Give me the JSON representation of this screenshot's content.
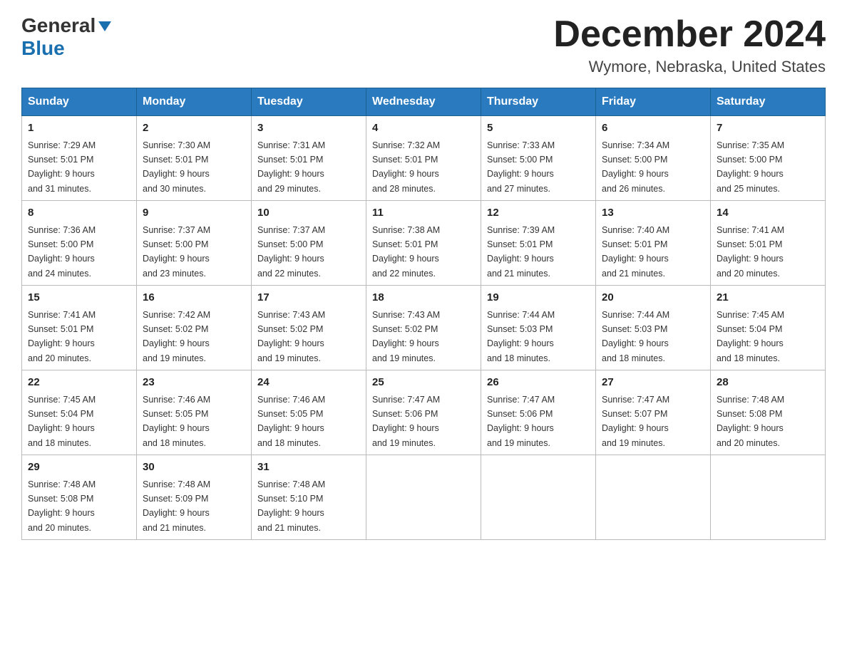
{
  "header": {
    "logo_general": "General",
    "logo_blue": "Blue",
    "month_title": "December 2024",
    "location": "Wymore, Nebraska, United States"
  },
  "weekdays": [
    "Sunday",
    "Monday",
    "Tuesday",
    "Wednesday",
    "Thursday",
    "Friday",
    "Saturday"
  ],
  "weeks": [
    [
      {
        "day": "1",
        "sunrise": "7:29 AM",
        "sunset": "5:01 PM",
        "daylight": "9 hours and 31 minutes."
      },
      {
        "day": "2",
        "sunrise": "7:30 AM",
        "sunset": "5:01 PM",
        "daylight": "9 hours and 30 minutes."
      },
      {
        "day": "3",
        "sunrise": "7:31 AM",
        "sunset": "5:01 PM",
        "daylight": "9 hours and 29 minutes."
      },
      {
        "day": "4",
        "sunrise": "7:32 AM",
        "sunset": "5:01 PM",
        "daylight": "9 hours and 28 minutes."
      },
      {
        "day": "5",
        "sunrise": "7:33 AM",
        "sunset": "5:00 PM",
        "daylight": "9 hours and 27 minutes."
      },
      {
        "day": "6",
        "sunrise": "7:34 AM",
        "sunset": "5:00 PM",
        "daylight": "9 hours and 26 minutes."
      },
      {
        "day": "7",
        "sunrise": "7:35 AM",
        "sunset": "5:00 PM",
        "daylight": "9 hours and 25 minutes."
      }
    ],
    [
      {
        "day": "8",
        "sunrise": "7:36 AM",
        "sunset": "5:00 PM",
        "daylight": "9 hours and 24 minutes."
      },
      {
        "day": "9",
        "sunrise": "7:37 AM",
        "sunset": "5:00 PM",
        "daylight": "9 hours and 23 minutes."
      },
      {
        "day": "10",
        "sunrise": "7:37 AM",
        "sunset": "5:00 PM",
        "daylight": "9 hours and 22 minutes."
      },
      {
        "day": "11",
        "sunrise": "7:38 AM",
        "sunset": "5:01 PM",
        "daylight": "9 hours and 22 minutes."
      },
      {
        "day": "12",
        "sunrise": "7:39 AM",
        "sunset": "5:01 PM",
        "daylight": "9 hours and 21 minutes."
      },
      {
        "day": "13",
        "sunrise": "7:40 AM",
        "sunset": "5:01 PM",
        "daylight": "9 hours and 21 minutes."
      },
      {
        "day": "14",
        "sunrise": "7:41 AM",
        "sunset": "5:01 PM",
        "daylight": "9 hours and 20 minutes."
      }
    ],
    [
      {
        "day": "15",
        "sunrise": "7:41 AM",
        "sunset": "5:01 PM",
        "daylight": "9 hours and 20 minutes."
      },
      {
        "day": "16",
        "sunrise": "7:42 AM",
        "sunset": "5:02 PM",
        "daylight": "9 hours and 19 minutes."
      },
      {
        "day": "17",
        "sunrise": "7:43 AM",
        "sunset": "5:02 PM",
        "daylight": "9 hours and 19 minutes."
      },
      {
        "day": "18",
        "sunrise": "7:43 AM",
        "sunset": "5:02 PM",
        "daylight": "9 hours and 19 minutes."
      },
      {
        "day": "19",
        "sunrise": "7:44 AM",
        "sunset": "5:03 PM",
        "daylight": "9 hours and 18 minutes."
      },
      {
        "day": "20",
        "sunrise": "7:44 AM",
        "sunset": "5:03 PM",
        "daylight": "9 hours and 18 minutes."
      },
      {
        "day": "21",
        "sunrise": "7:45 AM",
        "sunset": "5:04 PM",
        "daylight": "9 hours and 18 minutes."
      }
    ],
    [
      {
        "day": "22",
        "sunrise": "7:45 AM",
        "sunset": "5:04 PM",
        "daylight": "9 hours and 18 minutes."
      },
      {
        "day": "23",
        "sunrise": "7:46 AM",
        "sunset": "5:05 PM",
        "daylight": "9 hours and 18 minutes."
      },
      {
        "day": "24",
        "sunrise": "7:46 AM",
        "sunset": "5:05 PM",
        "daylight": "9 hours and 18 minutes."
      },
      {
        "day": "25",
        "sunrise": "7:47 AM",
        "sunset": "5:06 PM",
        "daylight": "9 hours and 19 minutes."
      },
      {
        "day": "26",
        "sunrise": "7:47 AM",
        "sunset": "5:06 PM",
        "daylight": "9 hours and 19 minutes."
      },
      {
        "day": "27",
        "sunrise": "7:47 AM",
        "sunset": "5:07 PM",
        "daylight": "9 hours and 19 minutes."
      },
      {
        "day": "28",
        "sunrise": "7:48 AM",
        "sunset": "5:08 PM",
        "daylight": "9 hours and 20 minutes."
      }
    ],
    [
      {
        "day": "29",
        "sunrise": "7:48 AM",
        "sunset": "5:08 PM",
        "daylight": "9 hours and 20 minutes."
      },
      {
        "day": "30",
        "sunrise": "7:48 AM",
        "sunset": "5:09 PM",
        "daylight": "9 hours and 21 minutes."
      },
      {
        "day": "31",
        "sunrise": "7:48 AM",
        "sunset": "5:10 PM",
        "daylight": "9 hours and 21 minutes."
      },
      null,
      null,
      null,
      null
    ]
  ],
  "labels": {
    "sunrise": "Sunrise: ",
    "sunset": "Sunset: ",
    "daylight": "Daylight: "
  }
}
